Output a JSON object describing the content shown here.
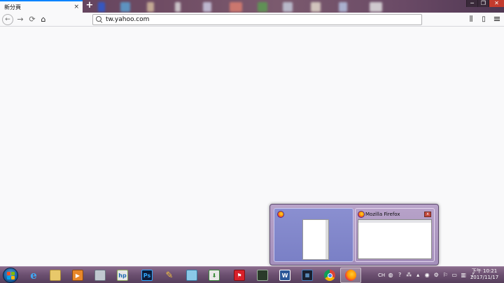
{
  "browser": {
    "tab_title": "新分頁",
    "tab_close_glyph": "×",
    "new_tab_glyph": "+",
    "window_controls": {
      "minimize": "─",
      "restore": "❐",
      "close": "✕"
    }
  },
  "navbar": {
    "back_glyph": "←",
    "forward_glyph": "→",
    "reload_glyph": "⟳",
    "home_glyph": "⌂",
    "url_value": "tw.yahoo.com",
    "library_glyph": "⫼",
    "sidebar_glyph": "▯",
    "menu_glyph": "≡"
  },
  "preview": {
    "window_title": "Mozilla Firefox",
    "close_glyph": "x"
  },
  "taskbar": {
    "photoshop_label": "Ps",
    "word_label": "W",
    "tray": {
      "language": "CH"
    },
    "clock": {
      "time": "下午 10:21",
      "date": "2017/11/17"
    }
  },
  "colors": {
    "accent": "#0a84ff",
    "taskbar": "#6b4f70",
    "firefox_orange": "#ff9500"
  }
}
